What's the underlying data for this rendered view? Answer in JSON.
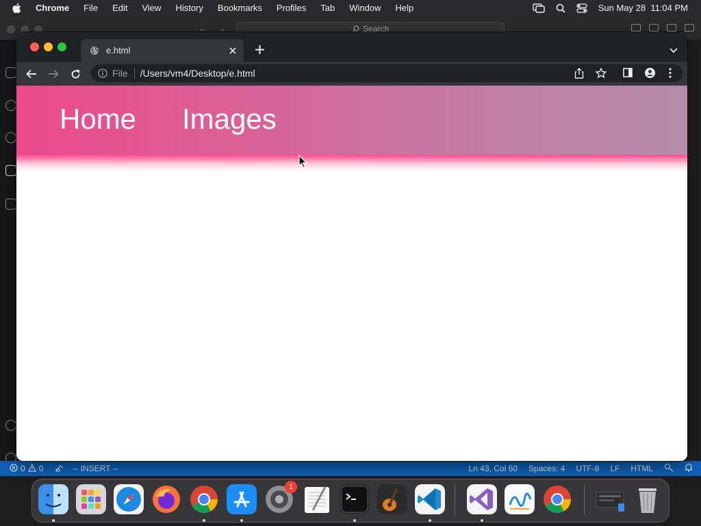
{
  "menubar": {
    "app_name": "Chrome",
    "items": [
      "File",
      "Edit",
      "View",
      "History",
      "Bookmarks",
      "Profiles",
      "Tab",
      "Window",
      "Help"
    ],
    "clock": "Sun May 28  11:04 PM"
  },
  "vscode": {
    "search_placeholder": "Search",
    "status": {
      "errors": "0",
      "warnings": "0",
      "mode": "-- INSERT --",
      "cursor_pos": "Ln 43, Col 60",
      "spaces": "Spaces: 4",
      "encoding": "UTF-8",
      "eol": "LF",
      "language": "HTML"
    }
  },
  "chrome": {
    "tab_title": "e.html",
    "scheme_label": "File",
    "url": "/Users/vm4/Desktop/e.html"
  },
  "page": {
    "nav": [
      "Home",
      "Images"
    ]
  },
  "dock": {
    "items": [
      "Finder",
      "Launchpad",
      "Safari",
      "Firefox",
      "Google Chrome",
      "App Store",
      "System Preferences",
      "TextEdit",
      "Terminal",
      "GarageBand",
      "Visual Studio Code",
      "Visual Studio",
      "Freeform",
      "Google Chrome",
      "Downloads",
      "Trash"
    ],
    "settings_badge": "1"
  },
  "colors": {
    "nav_gradient_start": "#ec4a8a",
    "nav_gradient_end": "#b58da8",
    "statusbar": "#0d61b7"
  }
}
